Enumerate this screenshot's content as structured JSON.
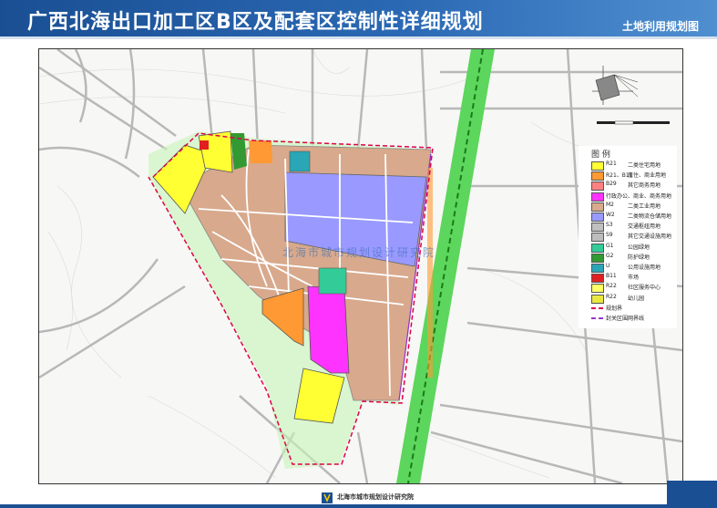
{
  "header": {
    "title": "广西北海出口加工区B区及配套区控制性详细规划",
    "subtitle": "土地利用规划图"
  },
  "legend": {
    "title": "图 例",
    "items": [
      {
        "code": "R21",
        "label": "二类住宅用地",
        "color": "#ffff33"
      },
      {
        "code": "R21、B11",
        "label": "居住、商业用地",
        "color": "#ff9933"
      },
      {
        "code": "B29",
        "label": "其它商务用地",
        "color": "#ff8080"
      },
      {
        "code": "",
        "label": "行政办公、商业、商务用地",
        "color": "#ff33ff"
      },
      {
        "code": "M2",
        "label": "二类工业用地",
        "color": "#d8a98c"
      },
      {
        "code": "W2",
        "label": "二类物流仓储用地",
        "color": "#9999ff"
      },
      {
        "code": "S3",
        "label": "交通枢纽用地",
        "color": "#c0c0c0"
      },
      {
        "code": "S9",
        "label": "其它交通设施用地",
        "color": "#bdbdbd"
      },
      {
        "code": "G1",
        "label": "公园绿地",
        "color": "#33cc99"
      },
      {
        "code": "G2",
        "label": "防护绿地",
        "color": "#339933"
      },
      {
        "code": "U",
        "label": "公用设施用地",
        "color": "#2aa6b6"
      },
      {
        "code": "B11",
        "label": "市场",
        "color": "#e02020"
      },
      {
        "code": "R22",
        "label": "社区服务中心",
        "color": "#ffff66"
      },
      {
        "code": "R22",
        "label": "幼儿园",
        "color": "#e8e840"
      },
      {
        "code": "",
        "label": "规划界",
        "color": "#e0004a"
      },
      {
        "code": "",
        "label": "封关区围网界线",
        "color": "#9933cc"
      }
    ]
  },
  "watermark": {
    "text": "北海市城市规划设计研究院"
  },
  "footer": {
    "org": "北海市城市规划设计研究院"
  },
  "colors": {
    "header": "#1a4f93",
    "green_corridor": "#33cc33",
    "boundary": "#e0004a"
  }
}
